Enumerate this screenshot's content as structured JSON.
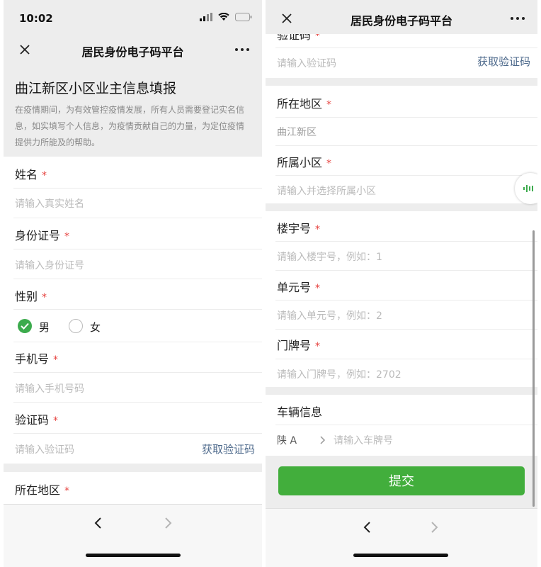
{
  "status": {
    "time": "10:02"
  },
  "nav": {
    "title": "居民身份电子码平台"
  },
  "intro": {
    "title": "曲江新区小区业主信息填报",
    "text": "在疫情期间，为有效管控疫情发展，所有人员需要登记实名信息，如实填写个人信息，为疫情贡献自己的力量，为定位疫情提供力所能及的帮助。"
  },
  "form": {
    "required_mark": "*",
    "name": {
      "label": "姓名",
      "placeholder": "请输入真实姓名"
    },
    "id_card": {
      "label": "身份证号",
      "placeholder": "请输入身份证号"
    },
    "gender": {
      "label": "性别",
      "male": "男",
      "female": "女",
      "selected": "男"
    },
    "phone": {
      "label": "手机号",
      "placeholder": "请输入手机号码"
    },
    "verify": {
      "label": "验证码",
      "placeholder": "请输入验证码",
      "get_code": "获取验证码"
    },
    "region": {
      "label": "所在地区",
      "value": "曲江新区"
    },
    "community": {
      "label": "所属小区",
      "placeholder": "请输入并选择所属小区"
    },
    "building": {
      "label": "楼宇号",
      "placeholder": "请输入楼宇号，例如：1"
    },
    "unit": {
      "label": "单元号",
      "placeholder": "请输入单元号，例如：2"
    },
    "door": {
      "label": "门牌号",
      "placeholder": "请输入门牌号，例如：2702"
    },
    "vehicle": {
      "label": "车辆信息",
      "prefix": "陕 A",
      "placeholder": "请输入车牌号"
    },
    "submit": "提交"
  },
  "colors": {
    "accent_green": "#42ae3c",
    "required_red": "#e64340",
    "link_blue": "#4e6a8c",
    "background": "#ededed"
  },
  "icons": [
    "close-icon",
    "more-icon",
    "wifi-icon",
    "battery-icon",
    "signal-icon",
    "chevron-left-icon",
    "chevron-right-icon",
    "check-icon",
    "voice-icon"
  ]
}
